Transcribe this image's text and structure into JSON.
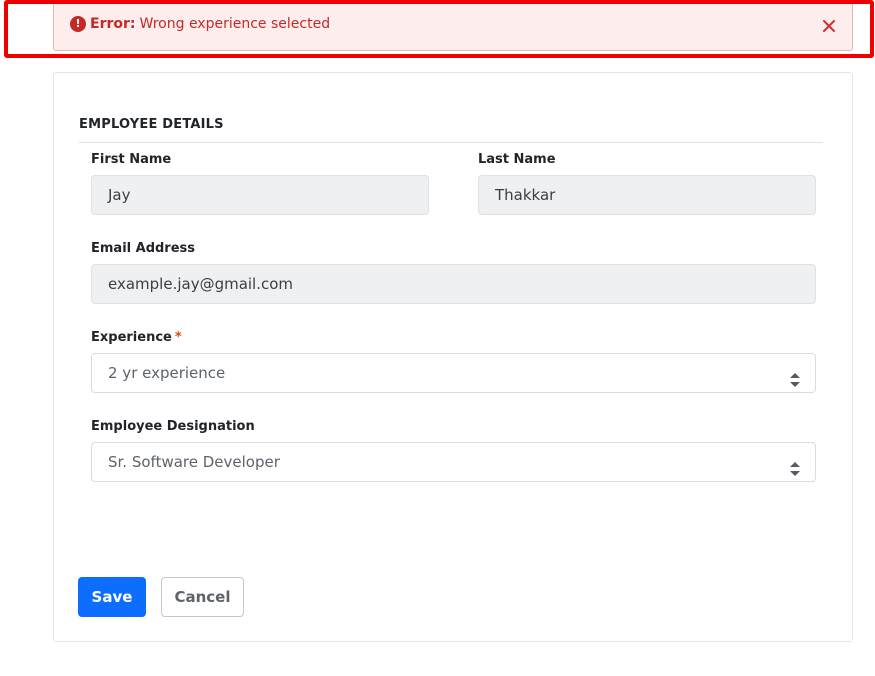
{
  "alert": {
    "prefix": "Error:",
    "message": "Wrong experience selected",
    "icon": "exclamation-circle-icon",
    "close_icon": "close-icon",
    "color": "#c62828",
    "background": "#fdeded"
  },
  "highlight": {
    "color": "#ee0000"
  },
  "form": {
    "section_title": "EMPLOYEE DETAILS",
    "first_name": {
      "label": "First Name",
      "value": "Jay"
    },
    "last_name": {
      "label": "Last Name",
      "value": "Thakkar"
    },
    "email": {
      "label": "Email Address",
      "value": "example.jay@gmail.com"
    },
    "experience": {
      "label": "Experience",
      "required_mark": "*",
      "value": "2 yr experience"
    },
    "designation": {
      "label": "Employee Designation",
      "value": "Sr. Software Developer"
    }
  },
  "actions": {
    "save_label": "Save",
    "cancel_label": "Cancel",
    "primary_color": "#0d6efd"
  }
}
